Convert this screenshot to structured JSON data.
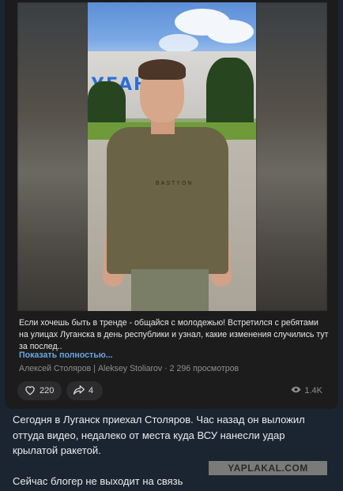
{
  "post": {
    "caption": "Если хочешь быть в тренде - общайся с молодежью! Встретился с ребятами на улицах Луганска в день республики и узнал, какие изменения случились тут за послед..",
    "show_more": "Показать полностью...",
    "author": "Алексей Столяров | Aleksey Stoliarov",
    "views_text": "2 296 просмотров",
    "video": {
      "building_sign": "УГАНСК",
      "shirt_text": "BASTYON"
    }
  },
  "reactions": {
    "likes": "220",
    "shares": "4",
    "views": "1.4K"
  },
  "comment": {
    "line1": "Сегодня в Луганск приехал Столяров. Час назад он выложил оттуда видео, недалеко от места куда ВСУ нанесли удар крылатой ракетой.",
    "line2": "Сейчас блогер не выходит на связь"
  },
  "watermark": "YAPLAKAL.COM",
  "colors": {
    "background": "#1b2532",
    "card": "#1c1c1d",
    "link": "#6aa7e0",
    "muted": "#8e8e8e"
  }
}
